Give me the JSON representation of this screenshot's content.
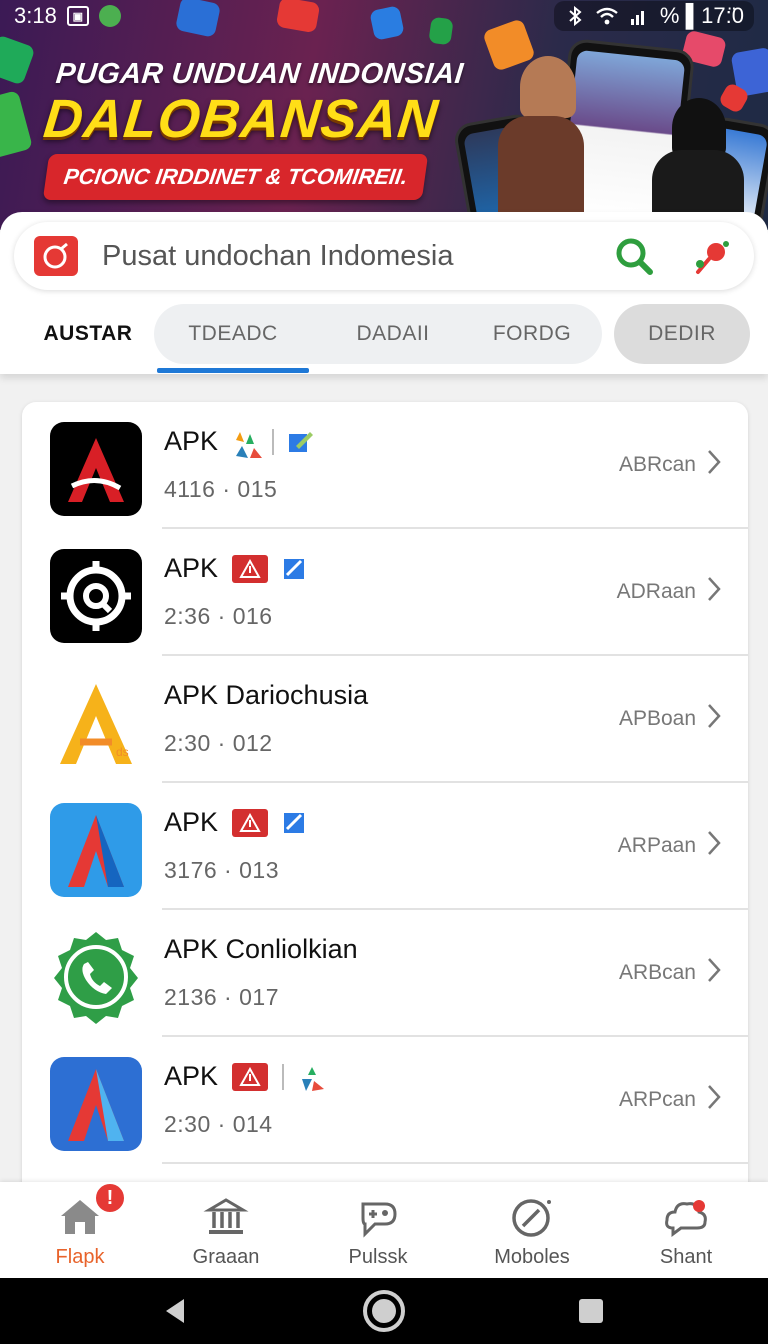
{
  "status_bar": {
    "time": "3:18",
    "right_text": "% ▌17:̈0",
    "icons": [
      "screenshot-icon",
      "chat-icon",
      "bluetooth-icon",
      "wifi-icon",
      "signal-icon",
      "battery-icon"
    ]
  },
  "banner": {
    "line1": "PUGAR UNDUAN INDONSIAI",
    "line2": "DALOBANSAN",
    "pill": "PCIONC IRDDINET & TCOMIREII."
  },
  "search": {
    "placeholder": "Pusat undochan Indomesia"
  },
  "tabs": [
    {
      "label": "AUSTAR",
      "active": true
    },
    {
      "label": "TDEADC",
      "active": false
    },
    {
      "label": "DADAII",
      "active": false
    },
    {
      "label": "FORDG",
      "active": false
    },
    {
      "label": "DEDIR",
      "active": false
    }
  ],
  "apps": [
    {
      "title": "APK",
      "subtitle": "4116 · 015",
      "action": "ABRcan",
      "icon": "red-a-logo-icon"
    },
    {
      "title": "APK",
      "subtitle": "2:36 · 016",
      "action": "ADRaan",
      "icon": "target-search-icon"
    },
    {
      "title": "APK Dariochusia",
      "subtitle": "2:30 · 012",
      "action": "APBoan",
      "icon": "yellow-a-logo-icon"
    },
    {
      "title": "APK",
      "subtitle": "3176 · 013",
      "action": "ARPaan",
      "icon": "blue-a-logo-icon"
    },
    {
      "title": "APK Conliolkian",
      "subtitle": "2136 · 017",
      "action": "ARBcan",
      "icon": "phone-badge-icon"
    },
    {
      "title": "APK",
      "subtitle": "2:30 · 014",
      "action": "ARPcan",
      "icon": "blue-red-a-logo-icon"
    }
  ],
  "bottom_nav": [
    {
      "label": "Flapk",
      "icon": "home-icon",
      "active": true,
      "badge": "!"
    },
    {
      "label": "Graaan",
      "icon": "bank-icon",
      "active": false
    },
    {
      "label": "Pulssk",
      "icon": "gamepad-tag-icon",
      "active": false
    },
    {
      "label": "Moboles",
      "icon": "compass-icon",
      "active": false
    },
    {
      "label": "Shant",
      "icon": "cloud-chat-icon",
      "active": false
    }
  ],
  "colors": {
    "accent": "#1e78d6",
    "active_nav": "#e8632b",
    "search_green": "#2e9e3e",
    "brand_red": "#e53935"
  }
}
